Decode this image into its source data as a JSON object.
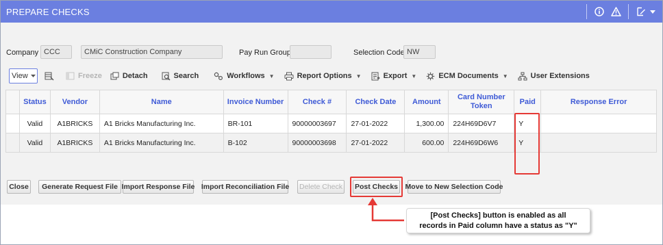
{
  "window": {
    "title": "PREPARE CHECKS",
    "header_icons": [
      "info-icon",
      "warning-icon",
      "edit-icon"
    ]
  },
  "filters": {
    "company_label": "Company",
    "company_code": "CCC",
    "company_name": "CMiC Construction Company",
    "pay_run_group_label": "Pay Run Group",
    "pay_run_group_value": "",
    "selection_code_label": "Selection Code",
    "selection_code_value": "NW"
  },
  "toolbar": {
    "view": "View",
    "freeze": "Freeze",
    "detach": "Detach",
    "search": "Search",
    "workflows": "Workflows",
    "report_options": "Report Options",
    "export": "Export",
    "ecm_documents": "ECM Documents",
    "user_extensions": "User Extensions"
  },
  "table": {
    "headers": {
      "status": "Status",
      "vendor": "Vendor",
      "name": "Name",
      "invoice": "Invoice Number",
      "check": "Check #",
      "check_date": "Check Date",
      "amount": "Amount",
      "card_token": "Card Number Token",
      "paid": "Paid",
      "response_error": "Response Error"
    },
    "rows": [
      {
        "status": "Valid",
        "vendor": "A1BRICKS",
        "name": "A1 Bricks Manufacturing Inc.",
        "invoice": "BR-101",
        "check": "90000003697",
        "check_date": "27-01-2022",
        "amount": "1,300.00",
        "card_token": "224H69D6V7",
        "paid": "Y",
        "response_error": ""
      },
      {
        "status": "Valid",
        "vendor": "A1BRICKS",
        "name": "A1 Bricks Manufacturing Inc.",
        "invoice": "B-102",
        "check": "90000003698",
        "check_date": "27-01-2022",
        "amount": "600.00",
        "card_token": "224H69D6W6",
        "paid": "Y",
        "response_error": ""
      }
    ]
  },
  "buttons": {
    "close": "Close",
    "generate_request": "Generate Request File",
    "import_response": "Import Response File",
    "import_reconciliation": "Import Reconciliation File",
    "delete_check": "Delete Check",
    "post_checks": "Post Checks",
    "move_selection": "Move to New Selection Code"
  },
  "annotation": {
    "line1": "[Post Checks] button is enabled as all",
    "line2": "records in Paid column have a status as \"Y\"",
    "color": "#e53935"
  },
  "colors": {
    "header_bg": "#6b7fe0",
    "grid_header_text": "#3e5ad6"
  }
}
